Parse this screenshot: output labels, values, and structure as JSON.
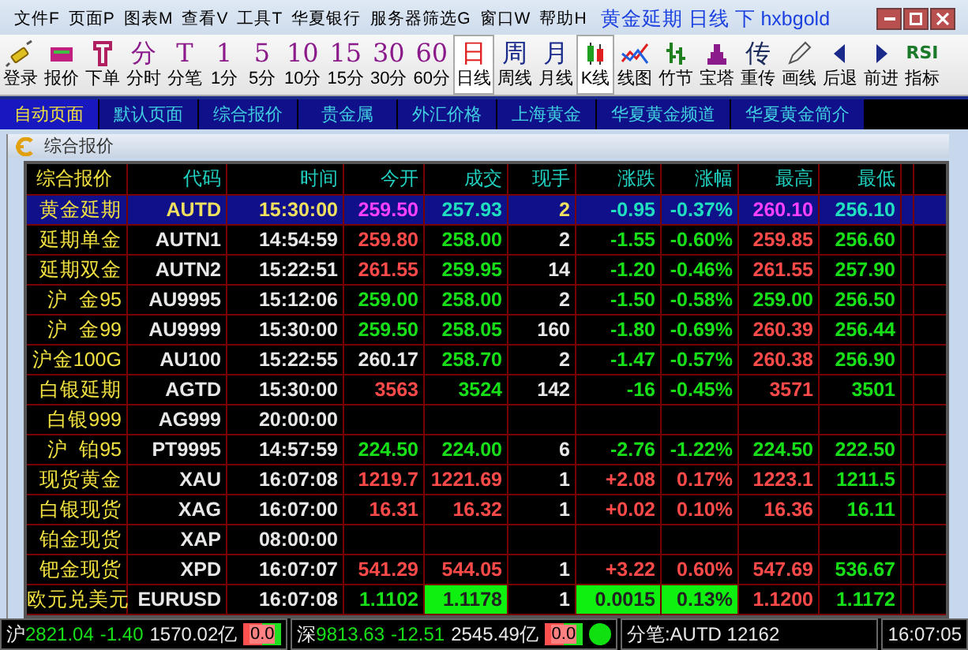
{
  "menu": [
    "文件F",
    "页面P",
    "图表M",
    "查看V",
    "工具T",
    "华夏银行",
    "服务器筛选G",
    "窗口W",
    "帮助H"
  ],
  "window": {
    "title": "黄金延期 日线 下 hxbgold"
  },
  "toolbar": [
    {
      "kind": "plug",
      "label": "登录",
      "selected": false
    },
    {
      "kind": "card",
      "label": "报价",
      "selected": false
    },
    {
      "kind": "order",
      "label": "下单",
      "selected": false
    },
    {
      "kind": "glyph",
      "glyph": "分",
      "color": "#8b1a8b",
      "label": "分时",
      "selected": false
    },
    {
      "kind": "glyph",
      "glyph": "T",
      "color": "#8b1a8b",
      "label": "分笔",
      "selected": false
    },
    {
      "kind": "glyph",
      "glyph": "1",
      "color": "#8b1a8b",
      "label": "1分",
      "selected": false
    },
    {
      "kind": "glyph",
      "glyph": "5",
      "color": "#8b1a8b",
      "label": "5分",
      "selected": false
    },
    {
      "kind": "glyph",
      "glyph": "10",
      "color": "#8b1a8b",
      "label": "10分",
      "selected": false
    },
    {
      "kind": "glyph",
      "glyph": "15",
      "color": "#8b1a8b",
      "label": "15分",
      "selected": false
    },
    {
      "kind": "glyph",
      "glyph": "30",
      "color": "#8b1a8b",
      "label": "30分",
      "selected": false
    },
    {
      "kind": "glyph",
      "glyph": "60",
      "color": "#8b1a8b",
      "label": "60分",
      "selected": false
    },
    {
      "kind": "glyph",
      "glyph": "日",
      "color": "#e02020",
      "label": "日线",
      "selected": true
    },
    {
      "kind": "glyph",
      "glyph": "周",
      "color": "#1a2a8b",
      "label": "周线",
      "selected": false
    },
    {
      "kind": "glyph",
      "glyph": "月",
      "color": "#1a2a8b",
      "label": "月线",
      "selected": false
    },
    {
      "kind": "candles",
      "label": "K线",
      "selected": true
    },
    {
      "kind": "linechart",
      "label": "线图",
      "selected": false
    },
    {
      "kind": "bamboo",
      "label": "竹节",
      "selected": false
    },
    {
      "kind": "tower",
      "label": "宝塔",
      "selected": false
    },
    {
      "kind": "glyph",
      "glyph": "传",
      "color": "#1a2a5b",
      "label": "重传",
      "selected": false
    },
    {
      "kind": "pencil",
      "label": "画线",
      "selected": false
    },
    {
      "kind": "left",
      "label": "后退",
      "selected": false
    },
    {
      "kind": "right",
      "label": "前进",
      "selected": false
    },
    {
      "kind": "glyph",
      "glyph": "RSI",
      "color": "#1a7a2a",
      "label": "指标",
      "selected": false
    }
  ],
  "tabs": [
    {
      "label": "自动页面",
      "selected": true
    },
    {
      "label": "默认页面",
      "selected": false
    },
    {
      "label": "综合报价",
      "selected": false
    },
    {
      "label": "贵金属",
      "selected": false
    },
    {
      "label": "外汇价格",
      "selected": false
    },
    {
      "label": "上海黄金",
      "selected": false
    },
    {
      "label": "华夏黄金频道",
      "selected": false
    },
    {
      "label": "华夏黄金简介",
      "selected": false
    }
  ],
  "panel": {
    "title": "综合报价"
  },
  "table": {
    "columns": [
      "综合报价",
      "代码",
      "时间",
      "今开",
      "成交",
      "现手",
      "涨跌",
      "涨幅",
      "最高",
      "最低"
    ],
    "rows": [
      {
        "name": "黄金延期",
        "code": "AUTD",
        "time": "15:30:00",
        "selected": true,
        "values": [
          {
            "text": "259.50",
            "kind": "pink"
          },
          {
            "text": "257.93",
            "kind": "cyan"
          },
          {
            "text": "2",
            "kind": "gold"
          },
          {
            "text": "-0.95",
            "kind": "cyan"
          },
          {
            "text": "-0.37%",
            "kind": "cyan"
          },
          {
            "text": "260.10",
            "kind": "pink"
          },
          {
            "text": "256.10",
            "kind": "cyan"
          }
        ]
      },
      {
        "name": "延期单金",
        "code": "AUTN1",
        "time": "14:54:59",
        "selected": false,
        "values": [
          {
            "text": "259.80",
            "kind": "up"
          },
          {
            "text": "258.00",
            "kind": "down"
          },
          {
            "text": "2",
            "kind": "flat"
          },
          {
            "text": "-1.55",
            "kind": "down"
          },
          {
            "text": "-0.60%",
            "kind": "down"
          },
          {
            "text": "259.85",
            "kind": "up"
          },
          {
            "text": "256.60",
            "kind": "down"
          }
        ]
      },
      {
        "name": "延期双金",
        "code": "AUTN2",
        "time": "15:22:51",
        "selected": false,
        "values": [
          {
            "text": "261.55",
            "kind": "up"
          },
          {
            "text": "259.95",
            "kind": "down"
          },
          {
            "text": "14",
            "kind": "flat"
          },
          {
            "text": "-1.20",
            "kind": "down"
          },
          {
            "text": "-0.46%",
            "kind": "down"
          },
          {
            "text": "261.55",
            "kind": "up"
          },
          {
            "text": "257.90",
            "kind": "down"
          }
        ]
      },
      {
        "name": "沪  金95",
        "code": "AU9995",
        "time": "15:12:06",
        "selected": false,
        "values": [
          {
            "text": "259.00",
            "kind": "down"
          },
          {
            "text": "258.00",
            "kind": "down"
          },
          {
            "text": "2",
            "kind": "flat"
          },
          {
            "text": "-1.50",
            "kind": "down"
          },
          {
            "text": "-0.58%",
            "kind": "down"
          },
          {
            "text": "259.00",
            "kind": "down"
          },
          {
            "text": "256.50",
            "kind": "down"
          }
        ]
      },
      {
        "name": "沪  金99",
        "code": "AU9999",
        "time": "15:30:00",
        "selected": false,
        "values": [
          {
            "text": "259.50",
            "kind": "down"
          },
          {
            "text": "258.05",
            "kind": "down"
          },
          {
            "text": "160",
            "kind": "flat"
          },
          {
            "text": "-1.80",
            "kind": "down"
          },
          {
            "text": "-0.69%",
            "kind": "down"
          },
          {
            "text": "260.39",
            "kind": "up"
          },
          {
            "text": "256.44",
            "kind": "down"
          }
        ]
      },
      {
        "name": "沪金100G",
        "code": "AU100",
        "time": "15:22:55",
        "selected": false,
        "values": [
          {
            "text": "260.17",
            "kind": "flat"
          },
          {
            "text": "258.70",
            "kind": "down"
          },
          {
            "text": "2",
            "kind": "flat"
          },
          {
            "text": "-1.47",
            "kind": "down"
          },
          {
            "text": "-0.57%",
            "kind": "down"
          },
          {
            "text": "260.38",
            "kind": "up"
          },
          {
            "text": "256.90",
            "kind": "down"
          }
        ]
      },
      {
        "name": "白银延期",
        "code": "AGTD",
        "time": "15:30:00",
        "selected": false,
        "values": [
          {
            "text": "3563",
            "kind": "up"
          },
          {
            "text": "3524",
            "kind": "down"
          },
          {
            "text": "142",
            "kind": "flat"
          },
          {
            "text": "-16",
            "kind": "down"
          },
          {
            "text": "-0.45%",
            "kind": "down"
          },
          {
            "text": "3571",
            "kind": "up"
          },
          {
            "text": "3501",
            "kind": "down"
          }
        ]
      },
      {
        "name": "白银999",
        "code": "AG999",
        "time": "20:00:00",
        "selected": false,
        "values": []
      },
      {
        "name": "沪  铂95",
        "code": "PT9995",
        "time": "14:57:59",
        "selected": false,
        "values": [
          {
            "text": "224.50",
            "kind": "down"
          },
          {
            "text": "224.00",
            "kind": "down"
          },
          {
            "text": "6",
            "kind": "flat"
          },
          {
            "text": "-2.76",
            "kind": "down"
          },
          {
            "text": "-1.22%",
            "kind": "down"
          },
          {
            "text": "224.50",
            "kind": "down"
          },
          {
            "text": "222.50",
            "kind": "down"
          }
        ]
      },
      {
        "name": "现货黄金",
        "code": "XAU",
        "time": "16:07:08",
        "selected": false,
        "values": [
          {
            "text": "1219.7",
            "kind": "up"
          },
          {
            "text": "1221.69",
            "kind": "up"
          },
          {
            "text": "1",
            "kind": "flat"
          },
          {
            "text": "+2.08",
            "kind": "up"
          },
          {
            "text": "0.17%",
            "kind": "up"
          },
          {
            "text": "1223.1",
            "kind": "up"
          },
          {
            "text": "1211.5",
            "kind": "down"
          }
        ]
      },
      {
        "name": "白银现货",
        "code": "XAG",
        "time": "16:07:00",
        "selected": false,
        "values": [
          {
            "text": "16.31",
            "kind": "up"
          },
          {
            "text": "16.32",
            "kind": "up"
          },
          {
            "text": "1",
            "kind": "flat"
          },
          {
            "text": "+0.02",
            "kind": "up"
          },
          {
            "text": "0.10%",
            "kind": "up"
          },
          {
            "text": "16.36",
            "kind": "up"
          },
          {
            "text": "16.11",
            "kind": "down"
          }
        ]
      },
      {
        "name": "铂金现货",
        "code": "XAP",
        "time": "08:00:00",
        "selected": false,
        "values": []
      },
      {
        "name": "钯金现货",
        "code": "XPD",
        "time": "16:07:07",
        "selected": false,
        "values": [
          {
            "text": "541.29",
            "kind": "up"
          },
          {
            "text": "544.05",
            "kind": "up"
          },
          {
            "text": "1",
            "kind": "flat"
          },
          {
            "text": "+3.22",
            "kind": "up"
          },
          {
            "text": "0.60%",
            "kind": "up"
          },
          {
            "text": "547.69",
            "kind": "up"
          },
          {
            "text": "536.67",
            "kind": "down"
          }
        ]
      },
      {
        "name": "欧元兑美元",
        "code": "EURUSD",
        "time": "16:07:08",
        "selected": false,
        "values": [
          {
            "text": "1.1102",
            "kind": "down"
          },
          {
            "text": "1.1178",
            "kind": "flash"
          },
          {
            "text": "1",
            "kind": "flat"
          },
          {
            "text": "0.0015",
            "kind": "flash"
          },
          {
            "text": "0.13%",
            "kind": "flash"
          },
          {
            "text": "1.1200",
            "kind": "up"
          },
          {
            "text": "1.1172",
            "kind": "down"
          }
        ]
      }
    ]
  },
  "status_bar": {
    "sh_label": "沪",
    "sh_index": "2821.04",
    "sh_change": "-1.40",
    "sh_amount": "1570.02亿",
    "sh_ratio": {
      "text": "0.0",
      "level": 0.5
    },
    "sz_label": "深",
    "sz_index": "9813.63",
    "sz_change": "-12.51",
    "sz_amount": "2545.49亿",
    "sz_ratio": {
      "text": "0.0",
      "level": 0.5
    },
    "connected": true,
    "tick": "分笔:AUTD 12162",
    "time": "16:07:05"
  }
}
